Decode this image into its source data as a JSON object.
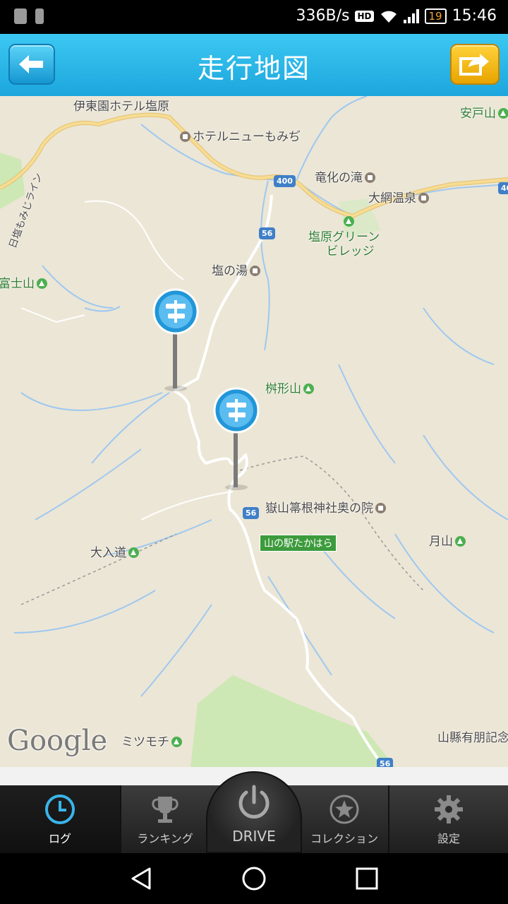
{
  "status_bar": {
    "net_speed": "336B/s",
    "hd_badge": "HD",
    "battery": "19",
    "time": "15:46"
  },
  "header": {
    "title": "走行地図",
    "back_icon": "arrow-left-icon",
    "share_icon": "share-arrow-icon"
  },
  "map": {
    "labels": {
      "hotel_shiobara": "伊東園ホテル塩原",
      "hotel_new_momiji": "ホテルニューもみぢ",
      "ryuka_falls": "竜化の滝",
      "oami_onsen": "大網温泉",
      "adosan": "安戸山",
      "shiobara_green_village_1": "塩原グリーン",
      "shiobara_green_village_2": "ビレッジ",
      "shio_no_yu": "塩の湯",
      "fujisan_partial": "富士山",
      "masugatayama": "桝形山",
      "takeyama_shrine": "嶽山箒根神社奥の院",
      "michi_no_eki": "山の駅たかはら",
      "oirimichi": "大入道",
      "gassan": "月山",
      "mitsumochi": "ミツモチ",
      "yamagata_memorial": "山縣有朋記念",
      "road_vertical": "日塩もみじライン"
    },
    "route_shields": [
      "400",
      "56",
      "56",
      "56",
      "40"
    ],
    "attribution": "Google",
    "colors": {
      "route": "#ffffff",
      "main_road": "#f5d58a",
      "river": "#9ec8f0",
      "forest": "#cde8b4",
      "pin": "#2196d8"
    }
  },
  "tabbar": {
    "tabs": [
      {
        "label": "ログ",
        "icon": "clock-icon",
        "active": true
      },
      {
        "label": "ランキング",
        "icon": "trophy-icon",
        "active": false
      },
      {
        "label": "DRIVE",
        "icon": "power-icon",
        "active": false
      },
      {
        "label": "コレクション",
        "icon": "star-icon",
        "active": false
      },
      {
        "label": "設定",
        "icon": "gear-icon",
        "active": false
      }
    ]
  }
}
